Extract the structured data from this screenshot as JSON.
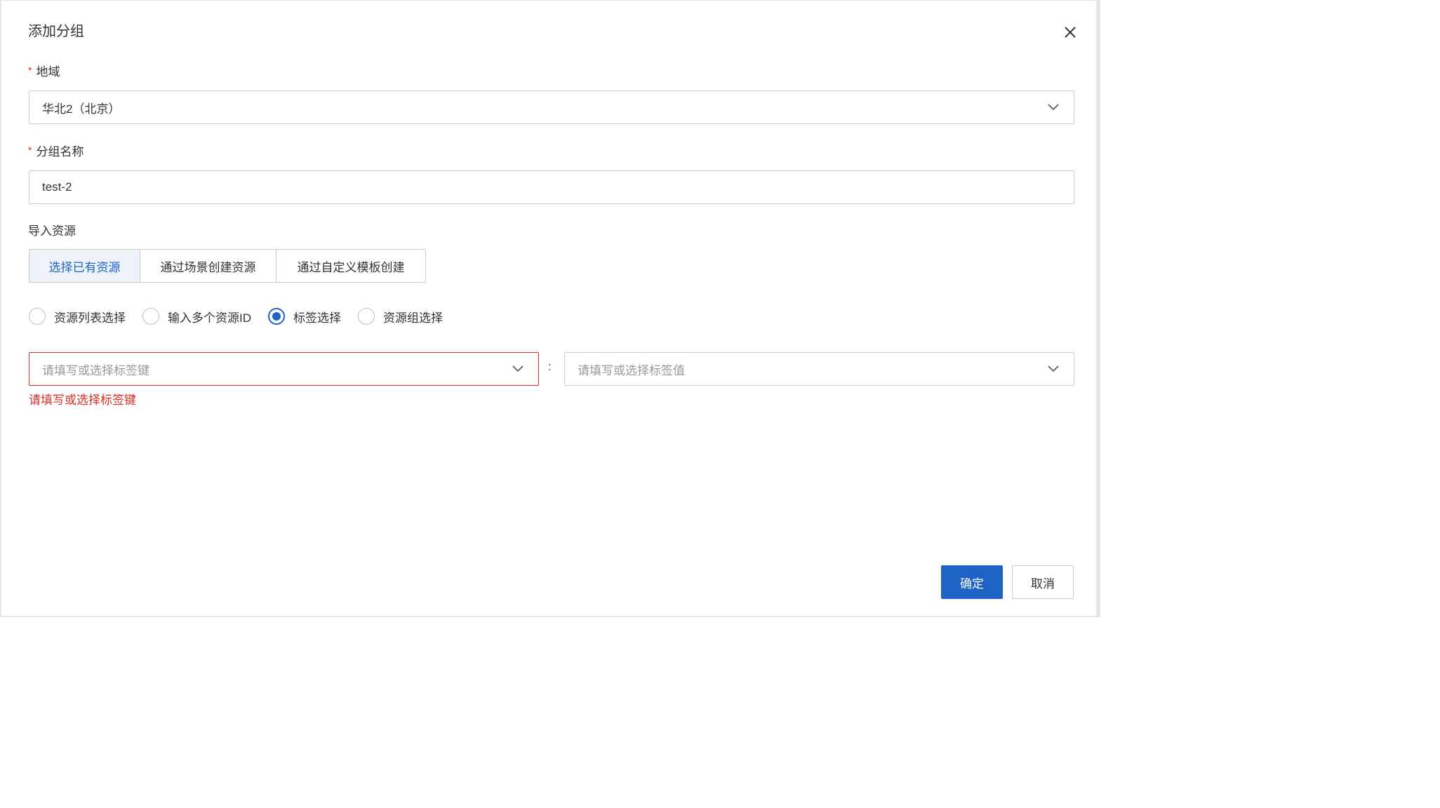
{
  "dialog": {
    "title": "添加分组",
    "close_icon": "close-icon"
  },
  "region": {
    "label": "地域",
    "required_mark": "*",
    "value": "华北2（北京）",
    "icon": "chevron-down-icon"
  },
  "group_name": {
    "label": "分组名称",
    "required_mark": "*",
    "value": "test-2"
  },
  "import_resources": {
    "label": "导入资源",
    "tabs": [
      {
        "label": "选择已有资源",
        "active": true
      },
      {
        "label": "通过场景创建资源",
        "active": false
      },
      {
        "label": "通过自定义模板创建",
        "active": false
      }
    ],
    "modes": [
      {
        "label": "资源列表选择",
        "checked": false
      },
      {
        "label": "输入多个资源ID",
        "checked": false
      },
      {
        "label": "标签选择",
        "checked": true
      },
      {
        "label": "资源组选择",
        "checked": false
      }
    ]
  },
  "tag": {
    "key_placeholder": "请填写或选择标签键",
    "separator": ":",
    "value_placeholder": "请填写或选择标签值",
    "error": "请填写或选择标签键"
  },
  "footer": {
    "confirm_label": "确定",
    "cancel_label": "取消"
  },
  "colors": {
    "primary": "#1f62c6",
    "error": "#d93026",
    "border": "#cccccc",
    "placeholder": "#999999"
  }
}
